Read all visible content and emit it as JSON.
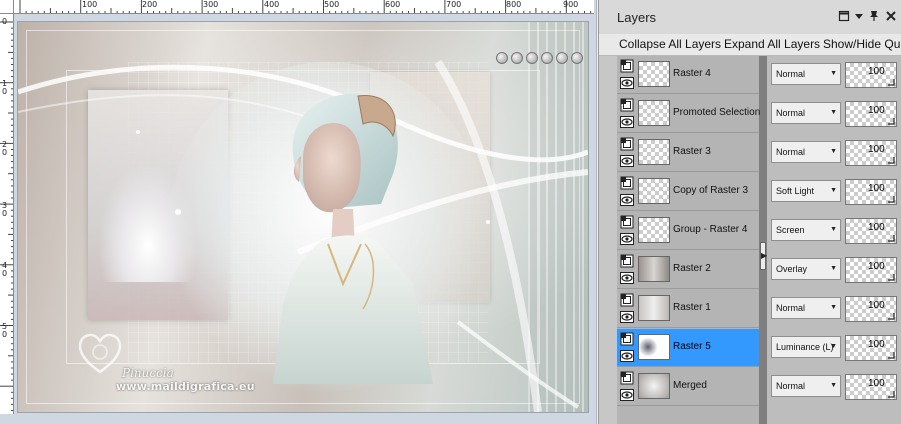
{
  "canvas": {
    "ruler_h_labels": [
      "100",
      "200",
      "300",
      "400",
      "500",
      "600",
      "700",
      "800",
      "900"
    ],
    "ruler_v_labels": [
      "0",
      "1\n0",
      "2\n0",
      "3\n0",
      "4\n0",
      "5\n0"
    ],
    "watermark_name": "Pinuccia",
    "watermark_site": "www.maildigrafica.eu"
  },
  "layers_panel": {
    "title": "Layers",
    "toolbar": {
      "collapse_all": "Collapse All Layers",
      "expand_all": "Expand All Layers",
      "show_hide": "Show/Hide Qui"
    },
    "layers": [
      {
        "name": "Raster 4",
        "blend": "Normal",
        "opacity": "100",
        "selected": false
      },
      {
        "name": "Promoted Selection",
        "blend": "Normal",
        "opacity": "100",
        "selected": false
      },
      {
        "name": "Raster 3",
        "blend": "Normal",
        "opacity": "100",
        "selected": false
      },
      {
        "name": "Copy of Raster 3",
        "blend": "Soft Light",
        "opacity": "100",
        "selected": false
      },
      {
        "name": "Group - Raster 4",
        "blend": "Screen",
        "opacity": "100",
        "selected": false
      },
      {
        "name": "Raster 2",
        "blend": "Overlay",
        "opacity": "100",
        "selected": false
      },
      {
        "name": "Raster 1",
        "blend": "Normal",
        "opacity": "100",
        "selected": false
      },
      {
        "name": "Raster 5",
        "blend": "Luminance (L)",
        "opacity": "100",
        "selected": true
      },
      {
        "name": "Merged",
        "blend": "Normal",
        "opacity": "100",
        "selected": false
      }
    ]
  },
  "colors": {
    "selection": "#3399ff",
    "palette_bg": "#c7c7c7"
  }
}
